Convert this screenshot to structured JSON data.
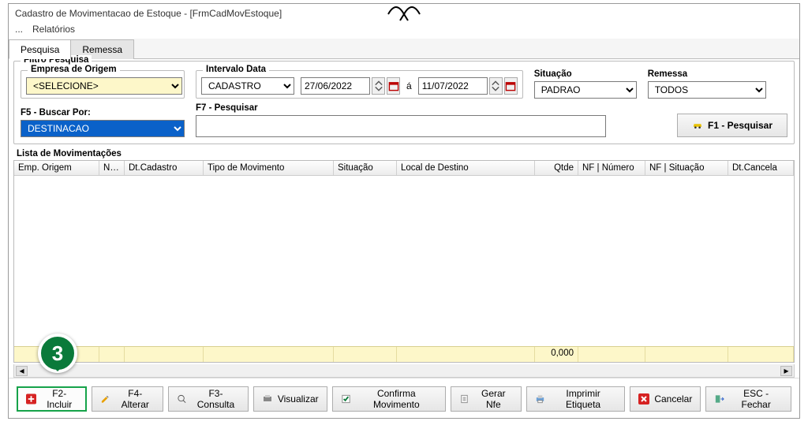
{
  "window": {
    "title": "Cadastro de Movimentacao de Estoque - [FrmCadMovEstoque]"
  },
  "menu": {
    "more": "...",
    "reports": "Relatórios"
  },
  "tabs": {
    "pesquisa": "Pesquisa",
    "remessa": "Remessa"
  },
  "filter": {
    "legend": "Filtro Pesquisa",
    "empresa_origem": {
      "label": "Empresa de Origem",
      "value": "<SELECIONE>"
    },
    "intervalo": {
      "label": "Intervalo Data",
      "tipo": "CADASTRO",
      "from": "27/06/2022",
      "sep": "á",
      "to": "11/07/2022"
    },
    "situacao": {
      "label": "Situação",
      "value": "PADRAO"
    },
    "remessa": {
      "label": "Remessa",
      "value": "TODOS"
    },
    "buscar_por": {
      "label": "F5 - Buscar Por:",
      "value": "DESTINACAO"
    },
    "pesquisar": {
      "label": "F7 - Pesquisar",
      "value": ""
    },
    "btn_pesquisar": "F1 - Pesquisar"
  },
  "grid": {
    "title": "Lista de Movimentações",
    "cols": [
      "Emp. Origem",
      "Nº Doc.",
      "Dt.Cadastro",
      "Tipo de Movimento",
      "Situação",
      "Local de Destino",
      "Qtde",
      "NF | Número",
      "NF | Situação",
      "Dt.Cancela"
    ],
    "footer_qtde": "0,000"
  },
  "footer": {
    "incluir": "F2-Incluir",
    "alterar": "F4-Alterar",
    "consulta": "F3-Consulta",
    "visualizar": "Visualizar",
    "confirma": "Confirma Movimento",
    "gerarnfe": "Gerar Nfe",
    "imprimir": "Imprimir Etiqueta",
    "cancelar": "Cancelar",
    "fechar": "ESC - Fechar"
  },
  "marker": "3"
}
